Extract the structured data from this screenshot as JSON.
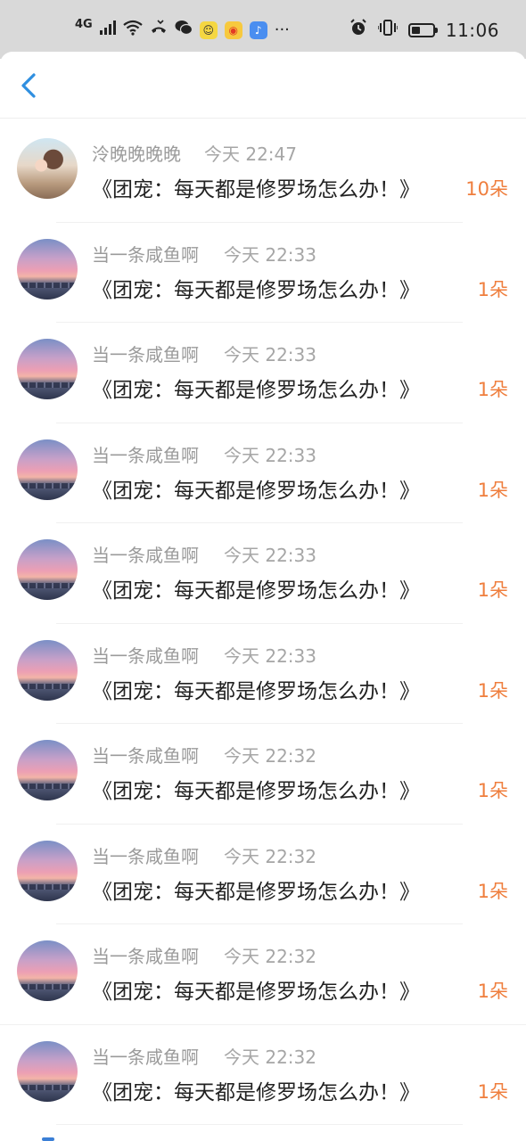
{
  "status_bar": {
    "network": "4G",
    "icons": [
      "signal-icon",
      "wifi-icon",
      "missed-call-icon",
      "wechat-icon",
      "app-icon-yellow",
      "weibo-icon",
      "music-icon",
      "more-dots-icon"
    ],
    "more": "···",
    "time": "11:06"
  },
  "nav": {
    "back_icon": "chevron-left-icon",
    "accent_color": "#2f8fe0"
  },
  "colors": {
    "count": "#ef7e3d",
    "name": "#9b9b9b",
    "text": "#222222"
  },
  "gifts": [
    {
      "name": "泠晚晚晚晚",
      "time": "今天 22:47",
      "book": "《团宠：每天都是修罗场怎么办！》",
      "count": "10朵",
      "avatar": "girl"
    },
    {
      "name": "当一条咸鱼啊",
      "time": "今天 22:33",
      "book": "《团宠：每天都是修罗场怎么办！》",
      "count": "1朵",
      "avatar": "sunset"
    },
    {
      "name": "当一条咸鱼啊",
      "time": "今天 22:33",
      "book": "《团宠：每天都是修罗场怎么办！》",
      "count": "1朵",
      "avatar": "sunset"
    },
    {
      "name": "当一条咸鱼啊",
      "time": "今天 22:33",
      "book": "《团宠：每天都是修罗场怎么办！》",
      "count": "1朵",
      "avatar": "sunset"
    },
    {
      "name": "当一条咸鱼啊",
      "time": "今天 22:33",
      "book": "《团宠：每天都是修罗场怎么办！》",
      "count": "1朵",
      "avatar": "sunset"
    },
    {
      "name": "当一条咸鱼啊",
      "time": "今天 22:33",
      "book": "《团宠：每天都是修罗场怎么办！》",
      "count": "1朵",
      "avatar": "sunset"
    },
    {
      "name": "当一条咸鱼啊",
      "time": "今天 22:32",
      "book": "《团宠：每天都是修罗场怎么办！》",
      "count": "1朵",
      "avatar": "sunset"
    },
    {
      "name": "当一条咸鱼啊",
      "time": "今天 22:32",
      "book": "《团宠：每天都是修罗场怎么办！》",
      "count": "1朵",
      "avatar": "sunset"
    },
    {
      "name": "当一条咸鱼啊",
      "time": "今天 22:32",
      "book": "《团宠：每天都是修罗场怎么办！》",
      "count": "1朵",
      "avatar": "sunset"
    },
    {
      "name": "当一条咸鱼啊",
      "time": "今天 22:32",
      "book": "《团宠：每天都是修罗场怎么办！》",
      "count": "1朵",
      "avatar": "sunset"
    }
  ]
}
